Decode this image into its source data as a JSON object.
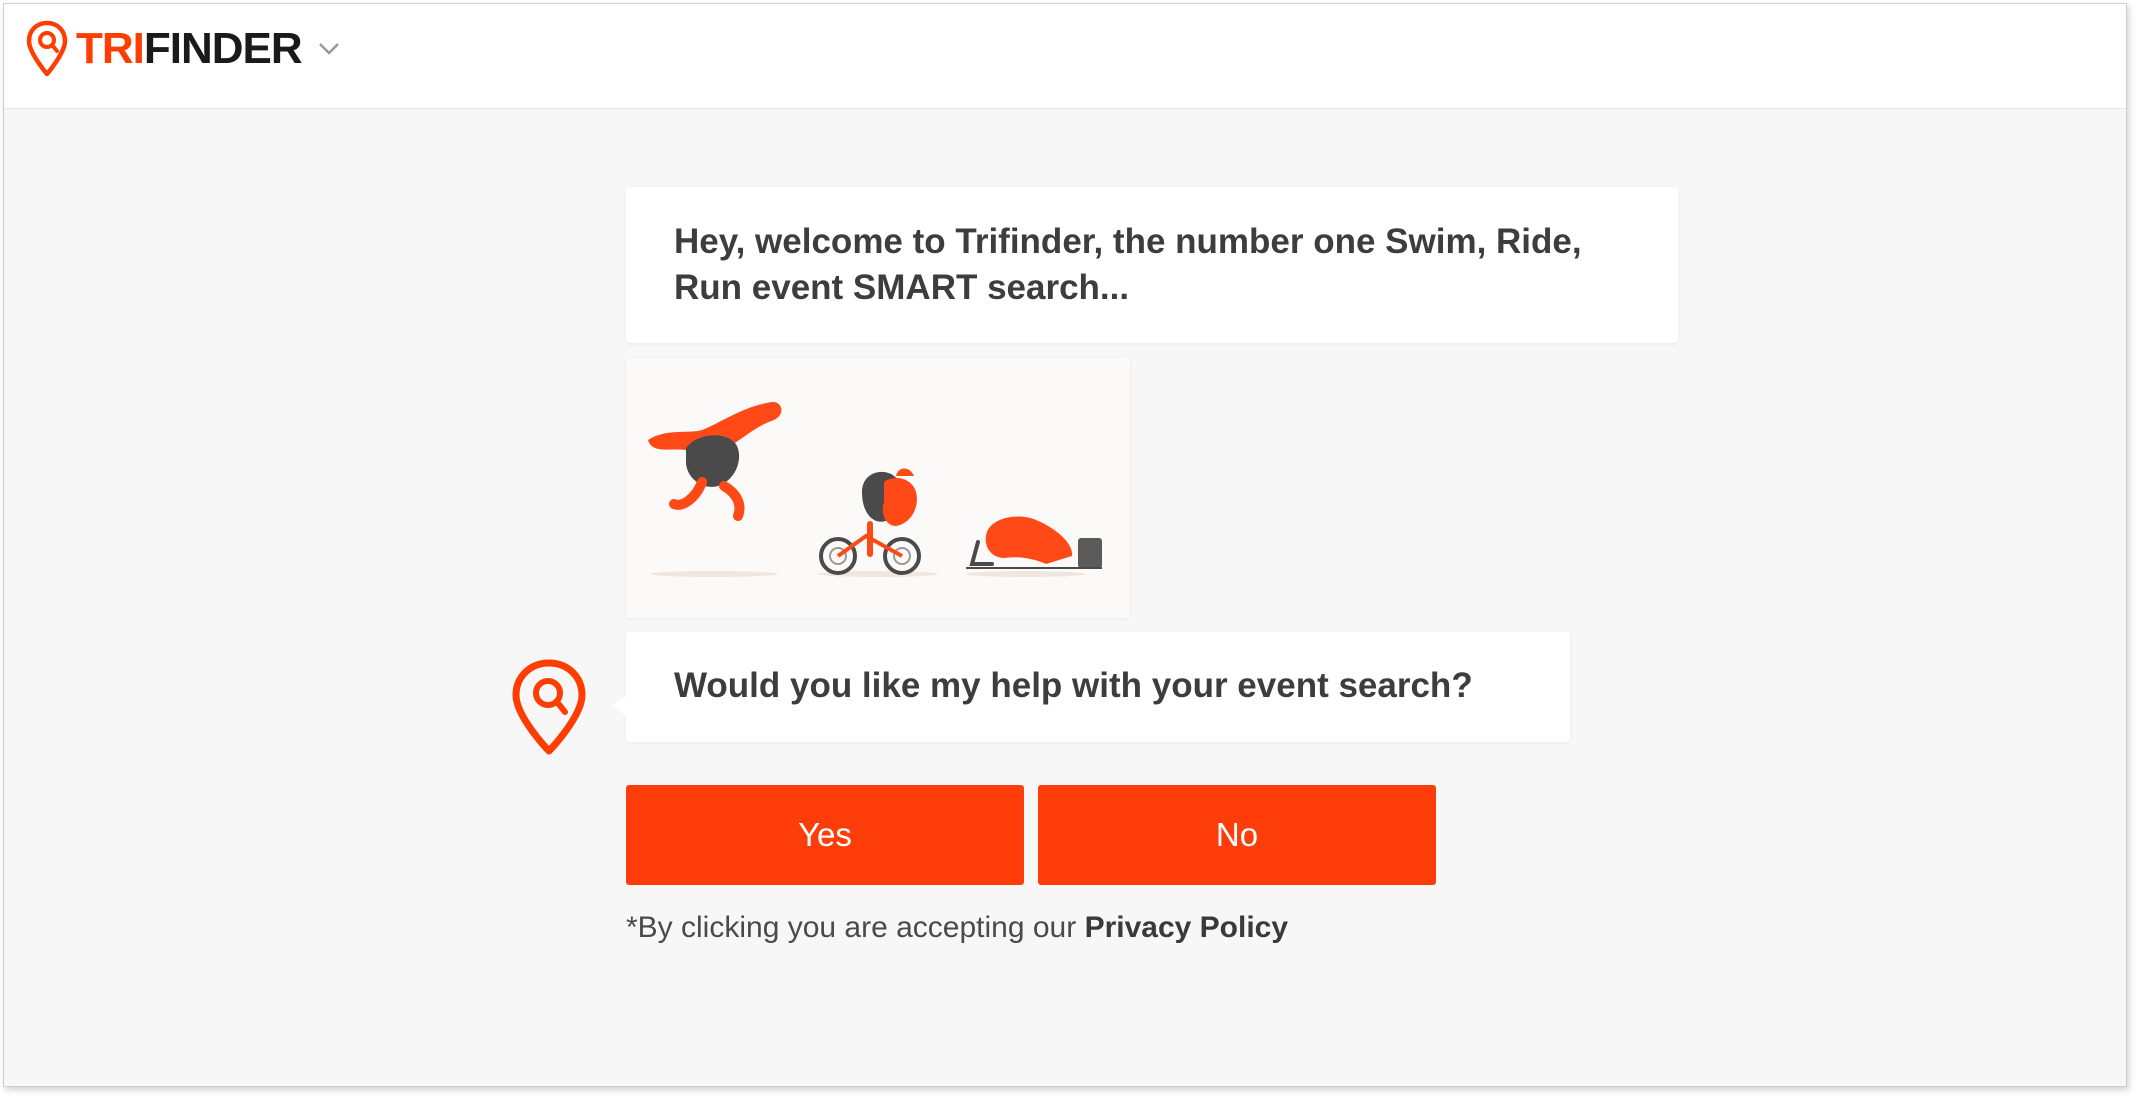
{
  "header": {
    "logo": {
      "prefix": "TRI",
      "suffix": "FINDER"
    },
    "icons": {
      "logo": "map-pin-search-icon",
      "menu": "chevron-down-icon"
    }
  },
  "chat": {
    "welcome_message": "Hey, welcome to Trifinder, the number one Swim, Ride, Run event SMART search...",
    "question": "Would you like my help with your event search?",
    "illustration": "swim-bike-run-illustration",
    "avatar_icon": "trifinder-pin-avatar-icon"
  },
  "actions": {
    "yes_label": "Yes",
    "no_label": "No"
  },
  "footer": {
    "disclaimer_text": "*By clicking you are accepting our ",
    "privacy_link": "Privacy Policy"
  },
  "colors": {
    "accent": "#ff3d00",
    "background": "#f7f7f7",
    "bubble": "#ffffff",
    "text_dark": "#3d3d3d"
  }
}
